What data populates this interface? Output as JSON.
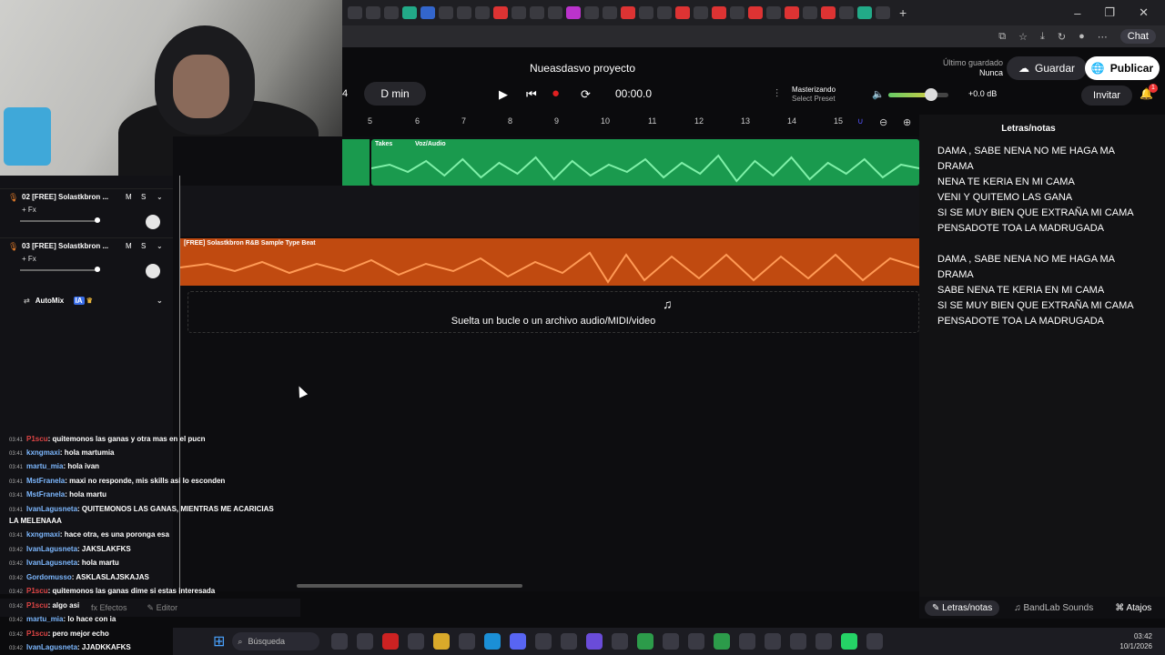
{
  "browser": {
    "chat_label": "Chat"
  },
  "header": {
    "project_title": "Nueasdasvo proyecto",
    "bars": "4",
    "key": "D min",
    "time": "00:00.0",
    "mastering_label": "Masterizando",
    "mastering_sub": "Select Preset",
    "gain": "+0.0 dB",
    "last_saved_label": "Último guardado",
    "last_saved_value": "Nunca",
    "save_label": "Guardar",
    "publish_label": "Publicar",
    "invite_label": "Invitar",
    "notif_count": "1"
  },
  "ruler": {
    "ticks": [
      "5",
      "6",
      "7",
      "8",
      "9",
      "10",
      "11",
      "12",
      "13",
      "14",
      "15"
    ]
  },
  "tracks": [
    {
      "num": "02",
      "name": "[FREE] Solastkbron ...",
      "fx": "+ Fx",
      "m": "M",
      "s": "S"
    },
    {
      "num": "03",
      "name": "[FREE] Solastkbron ...",
      "fx": "+ Fx",
      "m": "M",
      "s": "S"
    }
  ],
  "automix": {
    "label": "AutoMix",
    "badge": "IA"
  },
  "clips": {
    "takes_label": "Takes",
    "voice_label": "Voz/Audio",
    "beat_label": "[FREE] Solastkbron R&B Sample Type Beat"
  },
  "dropzone": {
    "text": "Suelta un bucle o un archivo audio/MIDI/video"
  },
  "lyrics": {
    "title": "Letras/notas",
    "lines": [
      "DAMA , SABE NENA NO ME HAGA MA",
      "DRAMA",
      "NENA TE KERIA EN MI CAMA",
      "VENI Y QUITEMO LAS GANA",
      "SI SE MUY BIEN QUE EXTRAÑA MI CAMA",
      "PENSADOTE TOA LA MADRUGADA",
      "DAMA , SABE NENA NO ME HAGA MA",
      "DRAMA",
      "SABE NENA TE KERIA EN MI CAMA",
      "SI SE MUY BIEN QUE EXTRAÑA MI CAMA",
      "PENSADOTE TOA LA MADRUGADA"
    ]
  },
  "bottombar": {
    "lyrics": "Letras/notas",
    "sounds": "BandLab Sounds",
    "shortcuts": "Atajos"
  },
  "editor_tabs": {
    "effects": "Efectos",
    "editor": "Editor"
  },
  "chat": [
    {
      "ts": "03:41",
      "user": "P1scu",
      "red": true,
      "msg": ": quitemonos las ganas y otra mas en el pucn"
    },
    {
      "ts": "03:41",
      "user": "kxngmaxi",
      "red": false,
      "msg": ": hola martumia"
    },
    {
      "ts": "03:41",
      "user": "martu_mia",
      "red": false,
      "msg": ": hola ivan"
    },
    {
      "ts": "03:41",
      "user": "MstFranela",
      "red": false,
      "msg": ": maxi no responde, mis skills asi lo esconden"
    },
    {
      "ts": "03:41",
      "user": "MstFranela",
      "red": false,
      "msg": ": hola martu"
    },
    {
      "ts": "03:41",
      "user": "IvanLagusneta",
      "red": false,
      "msg": ": QUITEMONOS LAS GANAS, MIENTRAS ME ACARICIAS"
    },
    {
      "ts": "",
      "user": "",
      "red": false,
      "msg": "LA MELENAAA"
    },
    {
      "ts": "03:41",
      "user": "kxngmaxi",
      "red": false,
      "msg": ": hace otra, es una poronga esa"
    },
    {
      "ts": "03:42",
      "user": "IvanLagusneta",
      "red": false,
      "msg": ": JAKSLAKFKS"
    },
    {
      "ts": "03:42",
      "user": "IvanLagusneta",
      "red": false,
      "msg": ": hola martu"
    },
    {
      "ts": "03:42",
      "user": "Gordomusso",
      "red": false,
      "msg": ": ASKLASLAJSKAJAS"
    },
    {
      "ts": "03:42",
      "user": "P1scu",
      "red": true,
      "msg": ": quitemonos las ganas dime si estas interesada"
    },
    {
      "ts": "03:42",
      "user": "P1scu",
      "red": true,
      "msg": ": algo asi"
    },
    {
      "ts": "03:42",
      "user": "martu_mia",
      "red": false,
      "msg": ": lo hace con ia"
    },
    {
      "ts": "03:42",
      "user": "P1scu",
      "red": true,
      "msg": ": pero mejor echo"
    },
    {
      "ts": "03:42",
      "user": "IvanLagusneta",
      "red": false,
      "msg": ": JJADKKAFKS"
    }
  ],
  "taskbar": {
    "search": "Búsqueda",
    "clock_time": "03:42",
    "clock_date": "10/1/2026"
  }
}
